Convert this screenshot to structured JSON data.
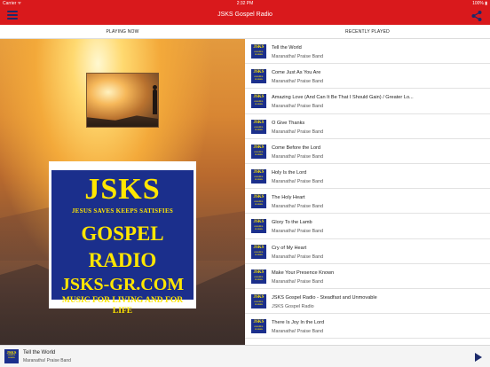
{
  "status_bar": {
    "carrier": "Carrier ᯤ",
    "time": "2:32 PM",
    "battery": "100% ▮"
  },
  "nav": {
    "title": "JSKS Gospel Radio",
    "menu_icon": "hamburger-menu-icon",
    "share_icon": "share-icon"
  },
  "tabs": [
    {
      "label": "PLAYING NOW"
    },
    {
      "label": "RECENTLY PLAYED"
    }
  ],
  "logo": {
    "name": "JSKS",
    "tagline": "JESUS SAVES KEEPS SATISFIES",
    "station": "GOSPEL RADIO",
    "url": "JSKS-GR.COM",
    "slogan": "MUSIC FOR LIVING AND FOR LIFE"
  },
  "art_label": {
    "top": "JSKS",
    "bottom": "GOSPEL RADIO"
  },
  "recently_played": [
    {
      "title": "Tell the World",
      "artist": "Maranatha! Praise Band"
    },
    {
      "title": "Come Just As You Are",
      "artist": "Maranatha! Praise Band"
    },
    {
      "title": "Amazing Love (And Can It Be That I Should Gain) / Greater Lo...",
      "artist": "Maranatha! Praise Band"
    },
    {
      "title": "O Give Thanks",
      "artist": "Maranatha! Praise Band"
    },
    {
      "title": "Come Before the Lord",
      "artist": "Maranatha! Praise Band"
    },
    {
      "title": "Holy Is the Lord",
      "artist": "Maranatha! Praise Band"
    },
    {
      "title": "The Holy Heart",
      "artist": "Maranatha! Praise Band"
    },
    {
      "title": "Glory To the Lamb",
      "artist": "Maranatha! Praise Band"
    },
    {
      "title": "Cry of My Heart",
      "artist": "Maranatha! Praise Band"
    },
    {
      "title": "Make Your Presence Known",
      "artist": "Maranatha! Praise Band"
    },
    {
      "title": "JSKS Gospel Radio - Steadfast and Unmovable",
      "artist": "JSKS Gospel Radio"
    },
    {
      "title": "There Is Joy In the Lord",
      "artist": "Maranatha! Praise Band"
    }
  ],
  "now_playing": {
    "title": "Tell the World",
    "artist": "Maranatha! Praise Band",
    "play_icon": "play-icon"
  },
  "colors": {
    "brand_red": "#d9191c",
    "logo_blue": "#1b2f8c",
    "logo_yellow": "#ffe600",
    "icon_navy": "#1c2a6b"
  }
}
